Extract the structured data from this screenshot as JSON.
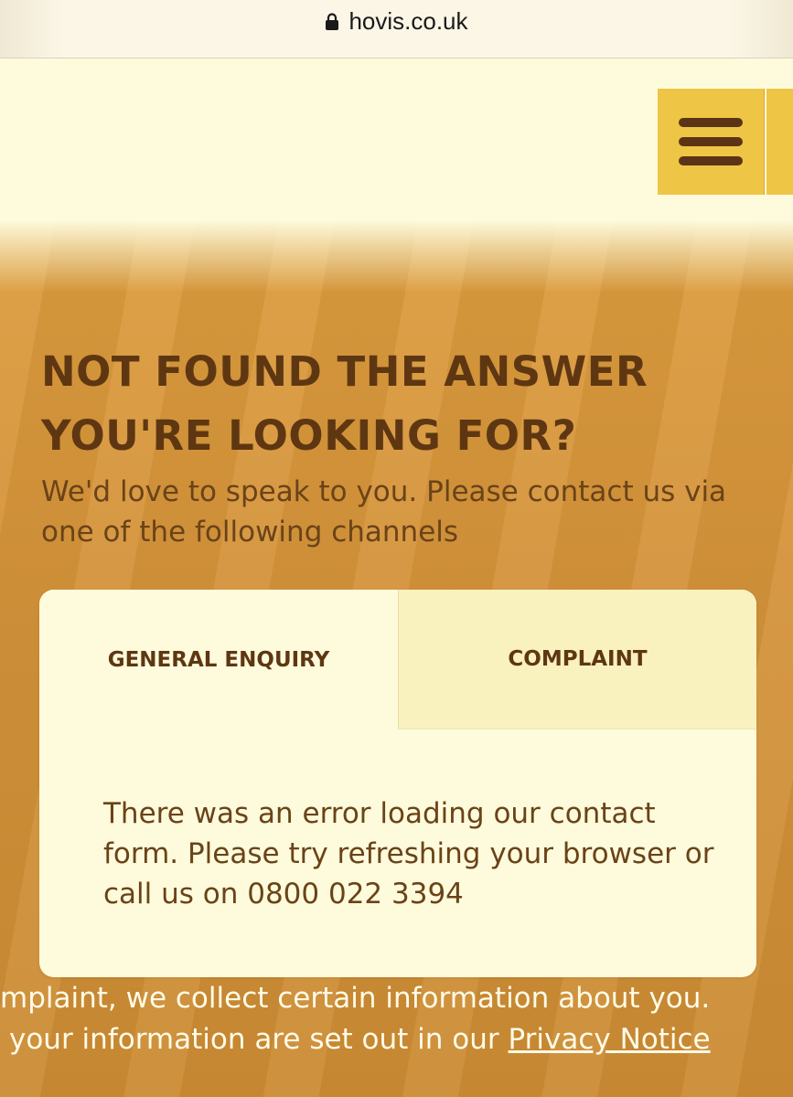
{
  "browser": {
    "url": "hovis.co.uk",
    "lock_icon": "lock-icon"
  },
  "header": {
    "menu_icon": "hamburger-icon",
    "accent_color": "#efc545"
  },
  "contact_section": {
    "heading": "NOT FOUND THE ANSWER YOU'RE LOOKING FOR?",
    "subtitle": "We'd love to speak to you. Please contact us via one of the following channels",
    "tabs": [
      {
        "label": "GENERAL ENQUIRY",
        "selected": true
      },
      {
        "label": "COMPLAINT",
        "selected": false
      }
    ],
    "error_message": "There was an error loading our contact form. Please try refreshing your browser or call us on 0800 022 3394"
  },
  "privacy": {
    "line1": "mplaint, we collect certain information about you.",
    "line2_prefix": "your information are set out in our ",
    "link_label": "Privacy Notice"
  },
  "colors": {
    "background": "#fefbdc",
    "band": "#d3923a",
    "heading": "#5e3712"
  }
}
